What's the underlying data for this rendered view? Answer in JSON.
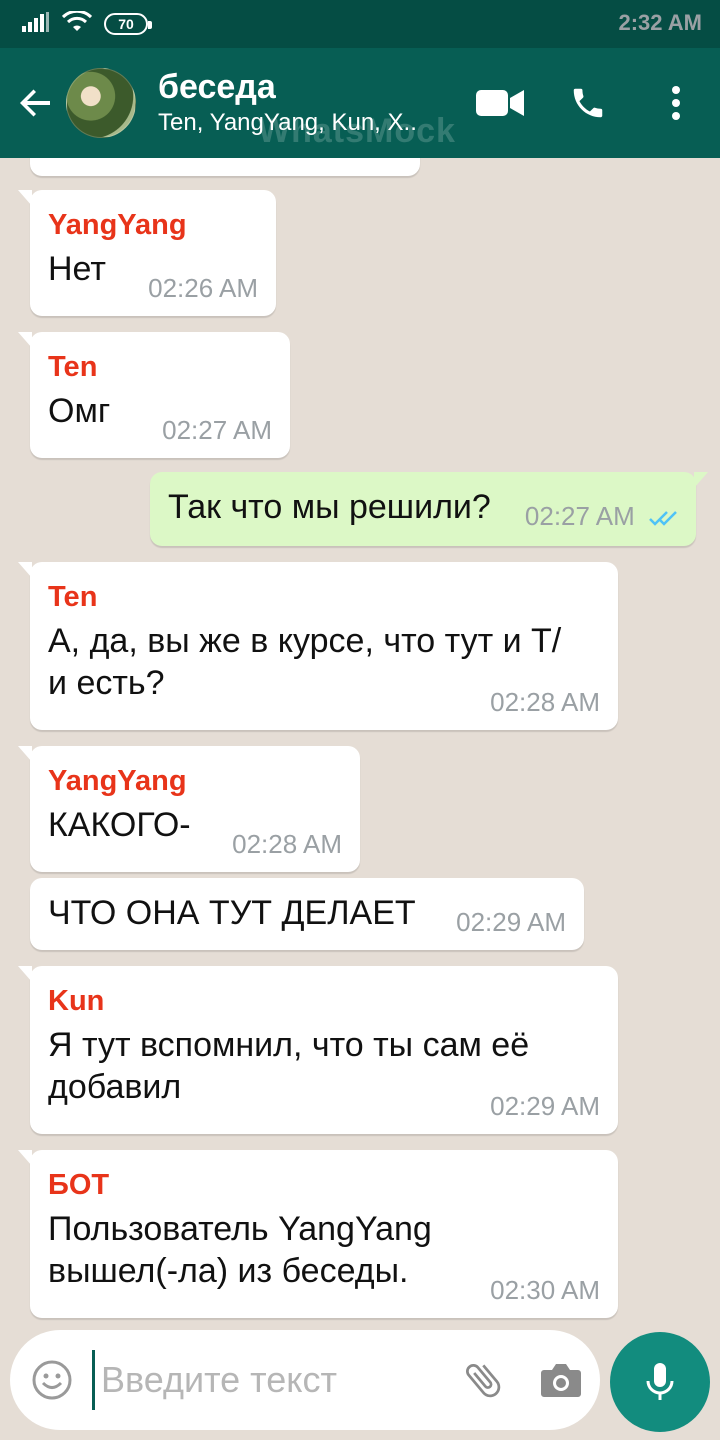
{
  "status_bar": {
    "time": "2:32 AM",
    "battery": "70",
    "icons": [
      "signal-icon",
      "wifi-icon",
      "battery-icon"
    ]
  },
  "header": {
    "title": "беседа",
    "subtitle": "Ten, YangYang, Kun, X..",
    "watermark": "WhatsMock",
    "actions": [
      "video-call-icon",
      "phone-icon",
      "more-icon"
    ]
  },
  "messages": [
    {
      "sender": "YangYang",
      "text": "Нет",
      "time": "02:26 AM",
      "direction": "in"
    },
    {
      "sender": "Ten",
      "text": "Омг",
      "time": "02:27 AM",
      "direction": "in"
    },
    {
      "sender": "",
      "text": "Так что мы решили?",
      "time": "02:27 AM",
      "direction": "out",
      "status": "read"
    },
    {
      "sender": "Ten",
      "text_line1": "А, да, вы же в курсе, что тут и Т/",
      "text_line2": "и есть?",
      "time": "02:28 AM",
      "direction": "in"
    },
    {
      "sender": "YangYang",
      "text": "КАКОГО-",
      "time": "02:28 AM",
      "direction": "in"
    },
    {
      "sender": "",
      "text": "ЧТО ОНА ТУТ ДЕЛАЕТ",
      "time": "02:29 AM",
      "direction": "in"
    },
    {
      "sender": "Kun",
      "text_line1": "Я тут вспомнил, что ты сам её",
      "text_line2": "добавил",
      "time": "02:29 AM",
      "direction": "in"
    },
    {
      "sender": "БОТ",
      "text_line1": "Пользователь YangYang",
      "text_line2": "вышел(-ла) из беседы.",
      "time": "02:30 AM",
      "direction": "in"
    }
  ],
  "composer": {
    "placeholder": "Введите текст",
    "value": ""
  },
  "colors": {
    "header": "#075e54",
    "status_bar": "#054d44",
    "sender_name": "#e8341a",
    "outgoing_bubble": "#dcf8c6",
    "fab": "#128c7e",
    "read_ticks": "#4fc3f7"
  }
}
